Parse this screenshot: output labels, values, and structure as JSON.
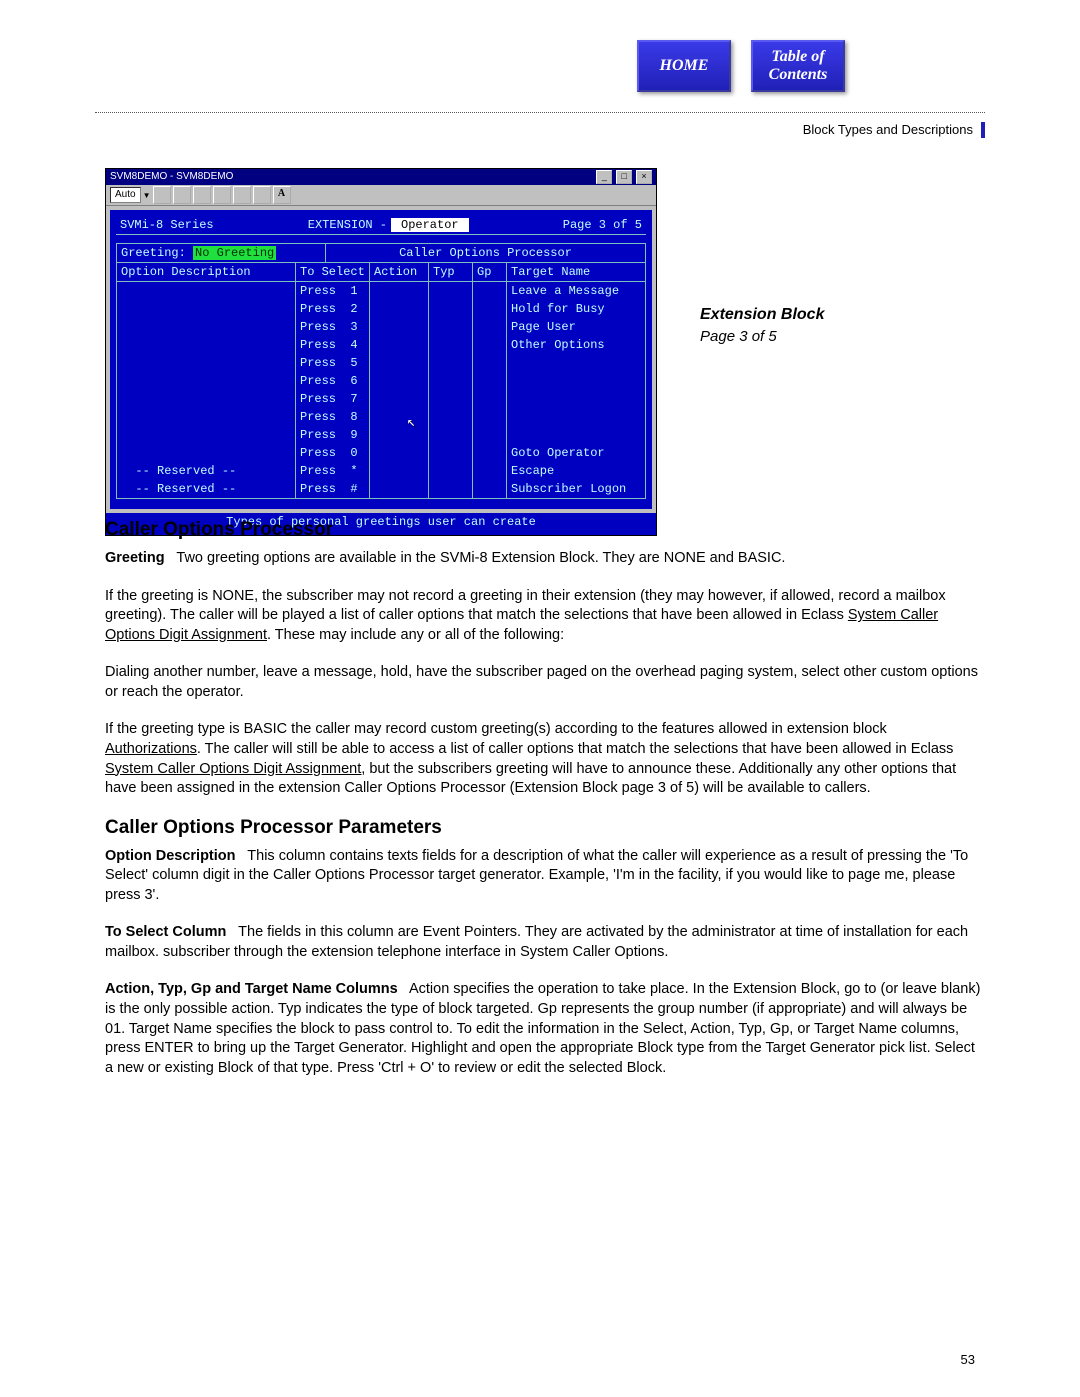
{
  "nav": {
    "home": "HOME",
    "toc": "Table of\nContents"
  },
  "breadcrumb": "Block Types and Descriptions",
  "screenshot": {
    "window_title": "SVM8DEMO - SVM8DEMO",
    "toolbar_mode": "Auto",
    "toolbar_bold": "A",
    "header": {
      "series": "SVMi-8 Series",
      "section_label": "EXTENSION -",
      "section_value": "Operator",
      "page": "Page 3 of 5"
    },
    "greeting_label": "Greeting:",
    "greeting_value": "No Greeting",
    "cop_title": "Caller Options Processor",
    "columns": {
      "opt": "Option Description",
      "sel": "To Select",
      "act": "Action",
      "typ": "Typ",
      "gp": "Gp",
      "tgt": "Target Name"
    },
    "rows": [
      {
        "opt": "",
        "sel": "Press  1",
        "act": "",
        "typ": "",
        "gp": "",
        "tgt": "Leave a Message"
      },
      {
        "opt": "",
        "sel": "Press  2",
        "act": "",
        "typ": "",
        "gp": "",
        "tgt": "Hold for Busy"
      },
      {
        "opt": "",
        "sel": "Press  3",
        "act": "",
        "typ": "",
        "gp": "",
        "tgt": "Page User"
      },
      {
        "opt": "",
        "sel": "Press  4",
        "act": "",
        "typ": "",
        "gp": "",
        "tgt": "Other Options"
      },
      {
        "opt": "",
        "sel": "Press  5",
        "act": "",
        "typ": "",
        "gp": "",
        "tgt": ""
      },
      {
        "opt": "",
        "sel": "Press  6",
        "act": "",
        "typ": "",
        "gp": "",
        "tgt": ""
      },
      {
        "opt": "",
        "sel": "Press  7",
        "act": "",
        "typ": "",
        "gp": "",
        "tgt": ""
      },
      {
        "opt": "",
        "sel": "Press  8",
        "act": "",
        "typ": "",
        "gp": "",
        "tgt": ""
      },
      {
        "opt": "",
        "sel": "Press  9",
        "act": "",
        "typ": "",
        "gp": "",
        "tgt": ""
      },
      {
        "opt": "",
        "sel": "Press  0",
        "act": "",
        "typ": "",
        "gp": "",
        "tgt": "Goto Operator"
      },
      {
        "opt": "  -- Reserved --",
        "sel": "Press  *",
        "act": "",
        "typ": "",
        "gp": "",
        "tgt": "Escape"
      },
      {
        "opt": "  -- Reserved --",
        "sel": "Press  #",
        "act": "",
        "typ": "",
        "gp": "",
        "tgt": "Subscriber Logon"
      }
    ],
    "hint": "Types of personal greetings user can create"
  },
  "side": {
    "title": "Extension Block",
    "sub": "Page 3 of 5"
  },
  "body": {
    "h1": "Caller Options Processor",
    "greeting_lead": "Greeting",
    "greeting_text1": "Two greeting options are available in the SVMi-8 Extension Block. They are NONE and BASIC.",
    "p2a": "If the greeting is NONE, the subscriber may not record a greeting in their extension (they may however, if allowed, record a mailbox greeting). The caller will be played a list of caller options that match the selections that have been allowed in Eclass ",
    "p2_ul": "System Caller Options Digit Assignment",
    "p2b": ". These may include any or all of the following:",
    "p3": "Dialing another number, leave a message, hold, have the subscriber paged on the overhead paging system, select other custom options or reach the operator.",
    "p4a": "If the greeting type is BASIC the caller may record custom greeting(s) according to the features allowed in extension block ",
    "p4_ul1": "Authorizations",
    "p4b": ". The caller will still be able to access a list of caller options that match the selections that have been allowed in Eclass ",
    "p4_ul2": "System Caller Options Digit Assignment,",
    "p4c": " but the subscribers greeting will have to announce these. Additionally any other options that have been assigned in the extension Caller Options Processor (Extension Block page 3 of 5) will be available to callers.",
    "h2": "Caller Options Processor Parameters",
    "opt_lead": "Option Description",
    "opt_text": "This column contains texts fields for a description of what the caller will experience as a result of pressing the 'To Select' column digit in the Caller Options Processor target generator. Example, 'I'm in the facility, if you would like to page me, please press 3'.",
    "sel_lead": "To Select Column",
    "sel_text": "The fields in this column are Event Pointers. They are activated by the administrator at time of installation for each mailbox. subscriber through the extension telephone interface in System Caller Options.",
    "rest_lead": "Action, Typ, Gp and Target Name Columns",
    "rest_text": "Action specifies the operation to take place. In the Extension Block, go to (or leave blank) is the only possible action. Typ indicates the type of block targeted.  Gp represents the group number (if appropriate) and will always be 01. Target Name specifies the block to pass control to.  To edit the information in the Select, Action, Typ, Gp, or Target Name columns, press ENTER to bring up the Target Generator.  Highlight and open the appropriate Block type from the Target Generator pick list.  Select a new or existing Block of that type.  Press 'Ctrl + O' to review or edit the selected Block."
  },
  "pagenum": "53"
}
